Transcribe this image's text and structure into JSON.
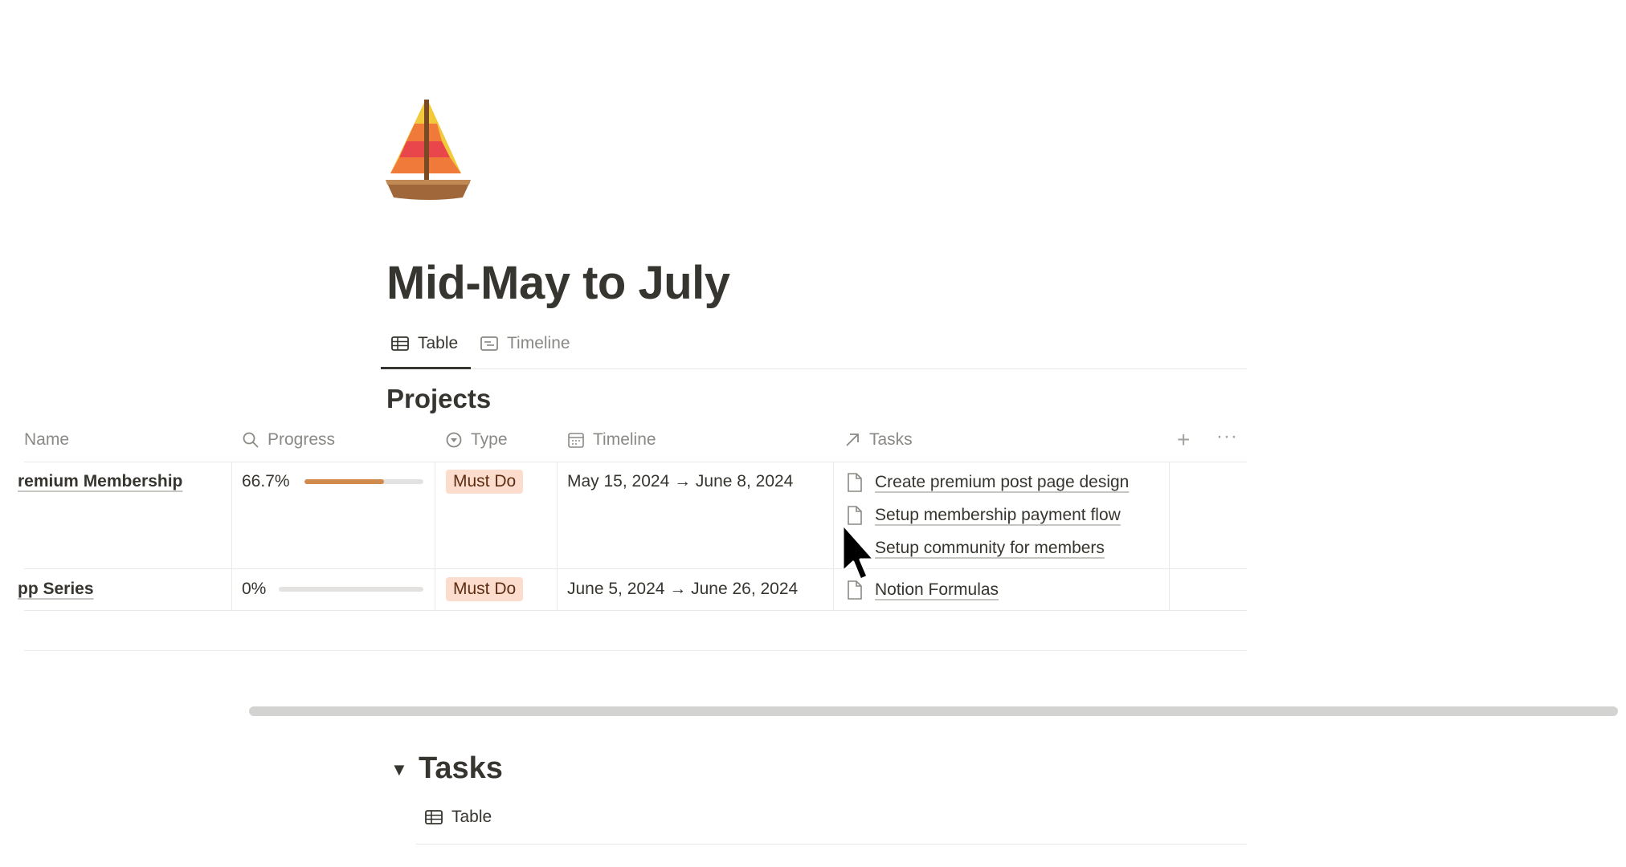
{
  "page": {
    "title": "Mid-May to July",
    "icon": "sailboat-icon"
  },
  "views": {
    "tabs": [
      {
        "label": "Table",
        "icon": "table-icon",
        "active": true
      },
      {
        "label": "Timeline",
        "icon": "timeline-icon",
        "active": false
      }
    ]
  },
  "database": {
    "title": "Projects",
    "columns": [
      {
        "label": "Name",
        "icon": ""
      },
      {
        "label": "Progress",
        "icon": "search-icon"
      },
      {
        "label": "Type",
        "icon": "select-icon"
      },
      {
        "label": "Timeline",
        "icon": "calendar-icon"
      },
      {
        "label": "Tasks",
        "icon": "relation-arrow-icon"
      }
    ],
    "rows": [
      {
        "name": "remium Membership",
        "progress_text": "66.7%",
        "progress_value": 0.667,
        "type": "Must Do",
        "timeline": "May 15, 2024 → June 8, 2024",
        "tasks": [
          "Create premium post page design",
          "Setup membership payment flow",
          "Setup community for members"
        ]
      },
      {
        "name": "pp Series",
        "progress_text": "0%",
        "progress_value": 0,
        "type": "Must Do",
        "timeline": "June 5, 2024 → June 26, 2024",
        "tasks": [
          "Notion Formulas"
        ]
      }
    ],
    "add_column": "+",
    "more": "···"
  },
  "tasks_section": {
    "title": "Tasks",
    "toggle": "▼",
    "view_tab": "Table"
  },
  "colors": {
    "text": "#37352f",
    "muted": "#8a8984",
    "progress_fill": "#d08a4c",
    "tag_bg": "#fbdccd"
  }
}
